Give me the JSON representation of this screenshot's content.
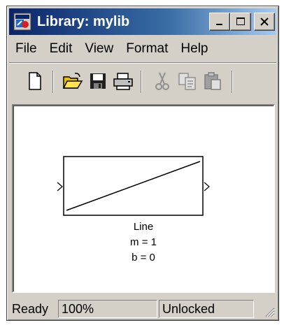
{
  "window": {
    "title": "Library: mylib"
  },
  "menu": {
    "items": [
      "File",
      "Edit",
      "View",
      "Format",
      "Help"
    ]
  },
  "toolbar": {
    "icons": [
      "new-icon",
      "open-icon",
      "save-icon",
      "print-icon",
      "cut-icon",
      "copy-icon",
      "paste-icon"
    ]
  },
  "block": {
    "name": "Line",
    "param1": "m = 1",
    "param2": "b = 0"
  },
  "status": {
    "ready": "Ready",
    "zoom": "100%",
    "lock": "Unlocked"
  }
}
